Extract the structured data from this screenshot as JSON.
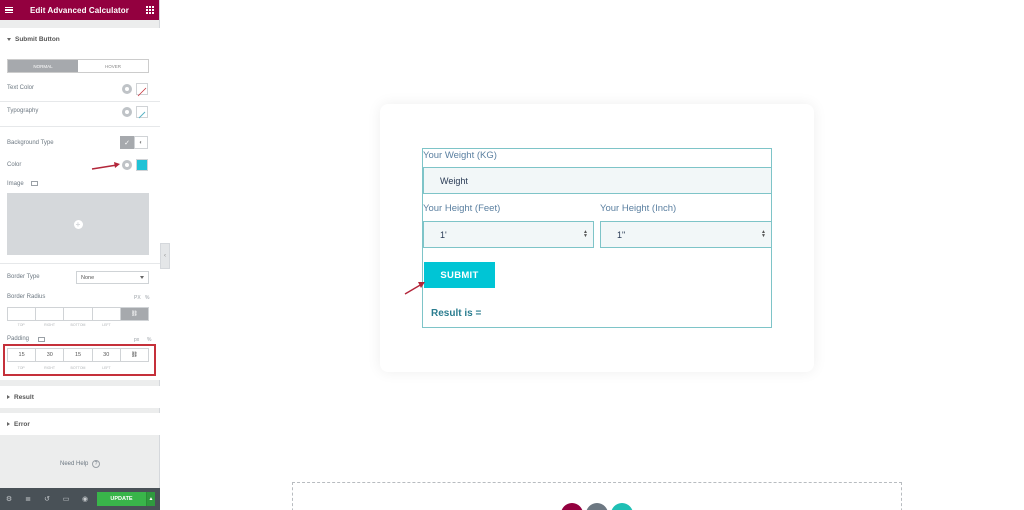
{
  "sidebar": {
    "title": "Edit Advanced Calculator",
    "section_submit": "Submit Button",
    "tabs": [
      "NORMAL",
      "HOVER"
    ],
    "text_color_label": "Text Color",
    "typography_label": "Typography",
    "background_type_label": "Background Type",
    "color_label": "Color",
    "color_swatch": "#1fc2d6",
    "image_label": "Image",
    "border_type_label": "Border Type",
    "border_type_value": "None",
    "border_radius_label": "Border Radius",
    "dim_units": [
      "TOP",
      "RIGHT",
      "BOTTOM",
      "LEFT"
    ],
    "padding_label": "Padding",
    "padding_unit": "px",
    "padding_values": [
      "15",
      "30",
      "15",
      "30"
    ],
    "section_result": "Result",
    "section_error": "Error",
    "need_help": "Need Help",
    "update_label": "UPDATE"
  },
  "calculator": {
    "weight_label": "Your Weight (KG)",
    "weight_placeholder": "Weight",
    "height_feet_label": "Your Height (Feet)",
    "height_feet_value": "1'",
    "height_inch_label": "Your Height (Inch)",
    "height_inch_value": "1\"",
    "submit_label": "SUBMIT",
    "result_label": "Result is =",
    "submit_color": "#00c5d5"
  },
  "colors": {
    "header": "#93003f",
    "update_green": "#39b54a",
    "annotation_red": "#c5303a"
  }
}
